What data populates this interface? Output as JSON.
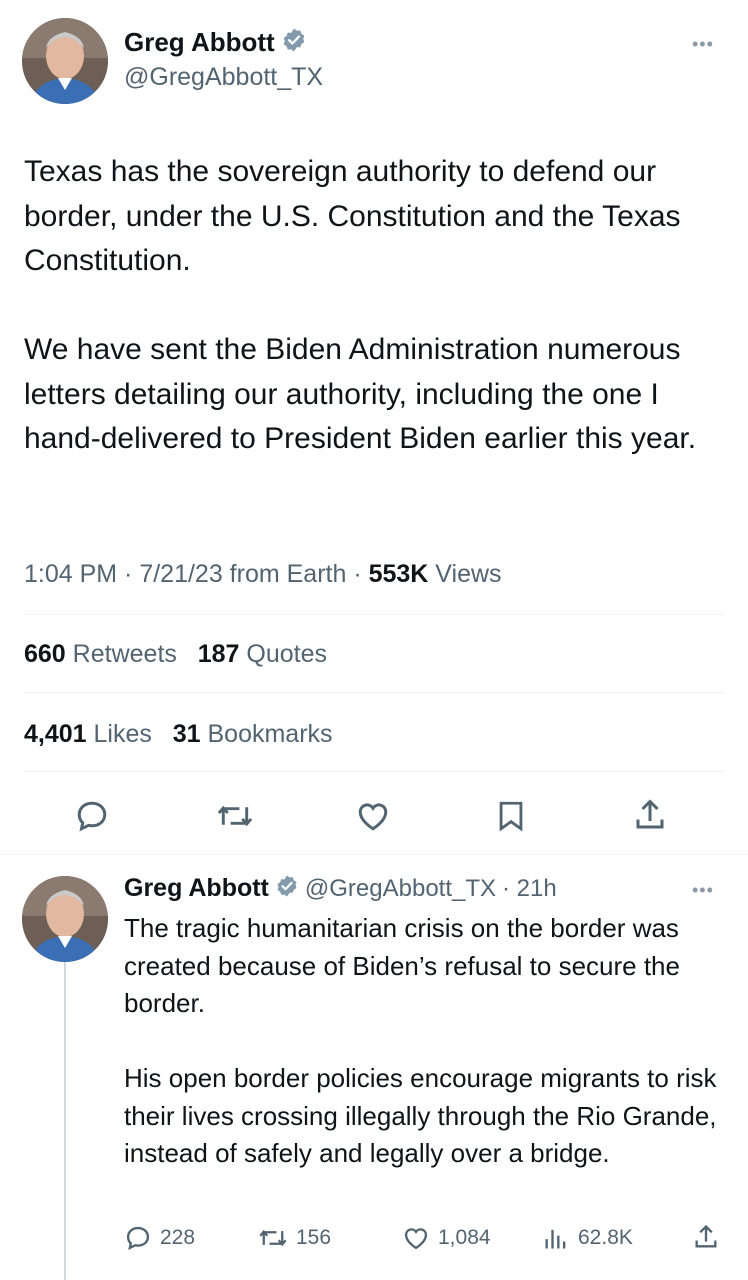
{
  "main_tweet": {
    "author": {
      "name": "Greg Abbott",
      "handle": "@GregAbbott_TX"
    },
    "more_label": "•••",
    "text_p1": "Texas has the sovereign authority to defend our border, under the U.S. Constitution and the Texas Constitution.",
    "text_p2": "We have sent the Biden Administration numerous letters detailing our authority, including the one I hand-delivered to President Biden earlier this year.",
    "meta": {
      "time_date": "1:04 PM · 7/21/23 from Earth · ",
      "views_count": "553K",
      "views_label": " Views"
    },
    "stats": {
      "retweets_count": "660",
      "retweets_label": "Retweets",
      "quotes_count": "187",
      "quotes_label": "Quotes",
      "likes_count": "4,401",
      "likes_label": "Likes",
      "bookmarks_count": "31",
      "bookmarks_label": "Bookmarks"
    },
    "actions": [
      "reply-icon",
      "retweet-icon",
      "like-icon",
      "bookmark-icon",
      "share-icon"
    ]
  },
  "reply_tweet": {
    "author": {
      "name": "Greg Abbott",
      "handle": "@GregAbbott_TX",
      "time": "· 21h"
    },
    "more_label": "•••",
    "text_p1": "The tragic humanitarian crisis on the border was created because of Biden’s refusal to secure the border.",
    "text_p2": "His open border policies encourage migrants to risk their lives crossing illegally through the Rio Grande, instead of safely and legally over a bridge.",
    "actions": {
      "replies": "228",
      "retweets": "156",
      "likes": "1,084",
      "views": "62.8K"
    }
  },
  "colors": {
    "text": "#0f1419",
    "secondary": "#536471",
    "verified_badge": "#829aab",
    "divider": "#eff3f4"
  }
}
